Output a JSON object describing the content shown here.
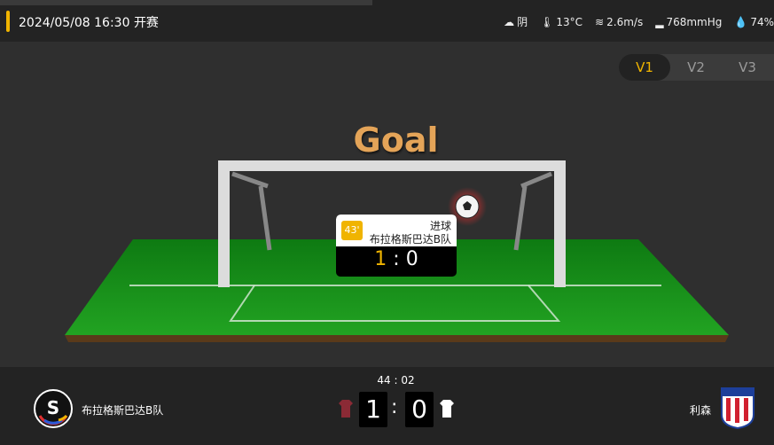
{
  "header": {
    "match_time": "2024/05/08 16:30 开赛",
    "weather": [
      {
        "icon": "cloud-icon",
        "glyph": "☁",
        "text": "阴"
      },
      {
        "icon": "thermometer-icon",
        "glyph": "🌡",
        "text": "13°C"
      },
      {
        "icon": "wind-icon",
        "glyph": "≋",
        "text": "2.6m/s"
      },
      {
        "icon": "pressure-icon",
        "glyph": "▂",
        "text": "768mmHg"
      },
      {
        "icon": "humidity-icon",
        "glyph": "💧",
        "text": "74%"
      }
    ]
  },
  "view_tabs": [
    {
      "label": "V1",
      "active": true
    },
    {
      "label": "V2",
      "active": false
    },
    {
      "label": "V3",
      "active": false
    }
  ],
  "animation": {
    "title": "Goal",
    "event": {
      "minute": "43'",
      "type": "进球",
      "team": "布拉格斯巴达B队",
      "score_home": "1",
      "score_sep": ":",
      "score_away": "0"
    }
  },
  "scoreboard": {
    "clock": "44 : 02",
    "home": {
      "name": "布拉格斯巴达B队",
      "score": "1",
      "shirt_color": "#8b2a35"
    },
    "away": {
      "name": "利森",
      "score": "0",
      "shirt_color": "#ffffff"
    },
    "separator": ":"
  },
  "colors": {
    "accent": "#f0b400",
    "pitch": "#1f8a1f"
  }
}
